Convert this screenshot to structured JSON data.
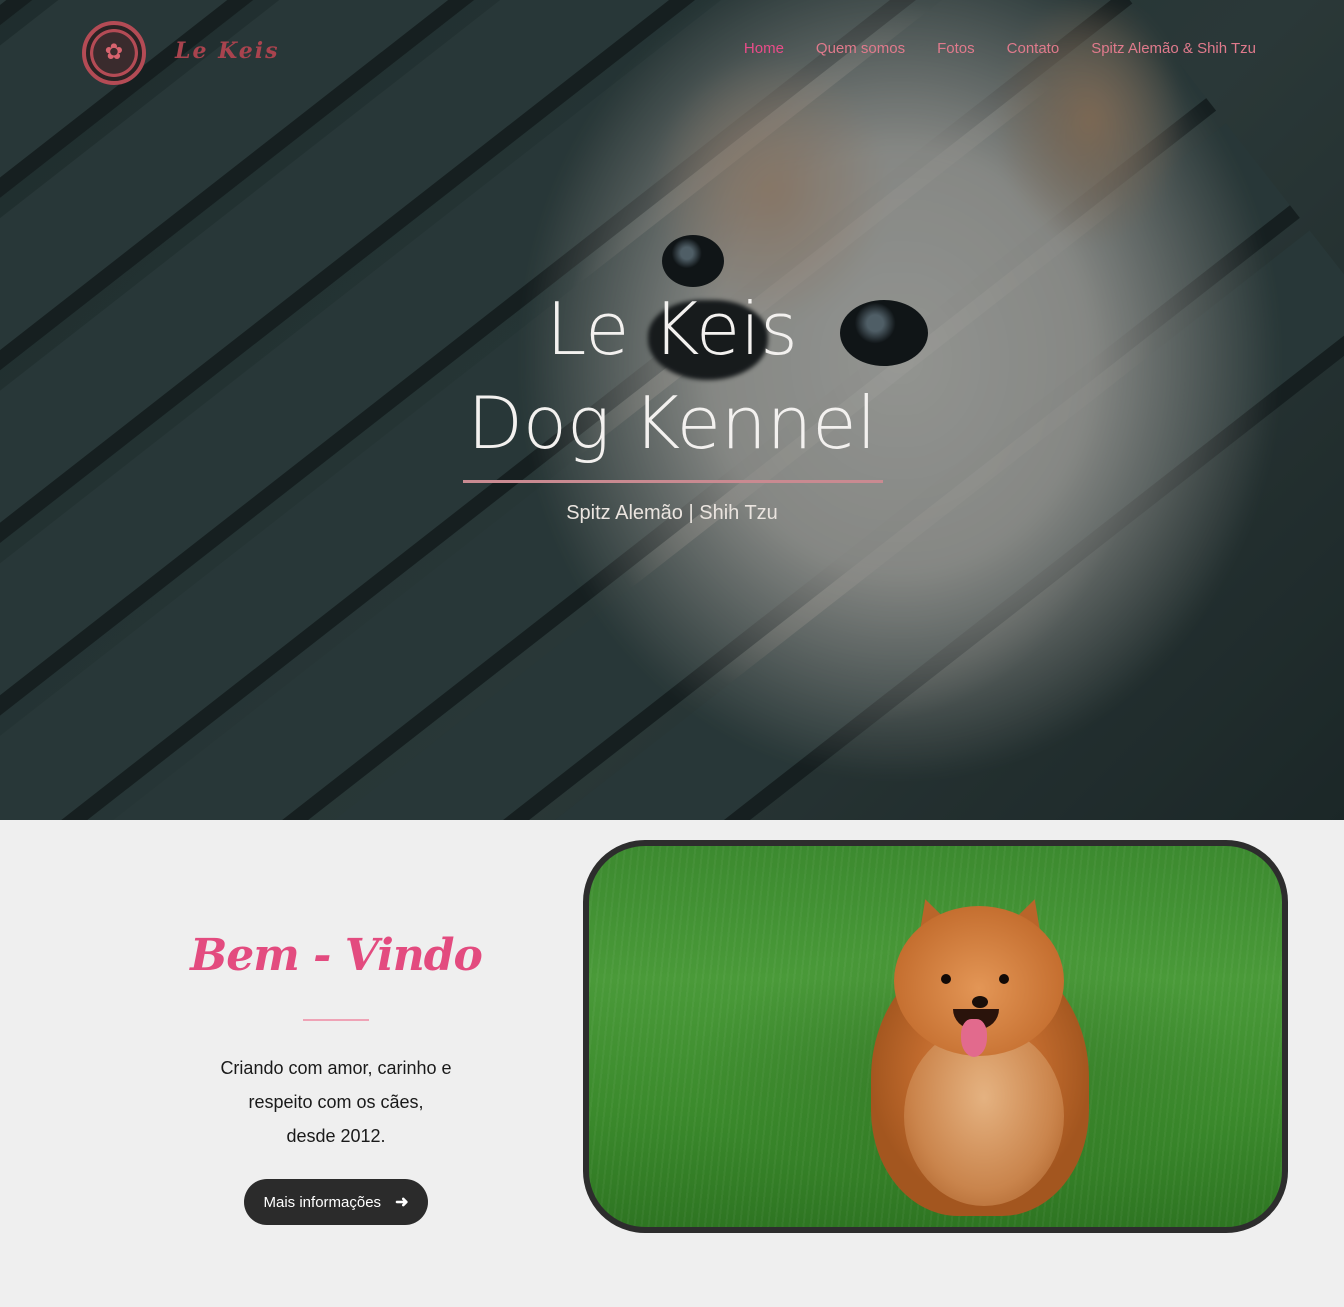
{
  "brand": {
    "logo_text": "Le  Keis"
  },
  "nav": {
    "items": [
      {
        "label": "Home",
        "active": true
      },
      {
        "label": "Quem somos"
      },
      {
        "label": "Fotos"
      },
      {
        "label": "Contato"
      },
      {
        "label": "Spitz Alemão & Shih Tzu"
      }
    ]
  },
  "hero": {
    "title_line1": "Le Keis",
    "title_line2": "Dog Kennel",
    "subtitle": "Spitz Alemão | Shih Tzu"
  },
  "welcome": {
    "title": "Bem - Vindo",
    "body_line1": "Criando com amor, carinho e",
    "body_line2": "respeito com os cães,",
    "body_line3": "desde 2012.",
    "button_label": "Mais informações"
  },
  "colors": {
    "accent_pink": "#e34b7f",
    "nav_pink": "#e07a8c",
    "button_dark": "#2b2b2b",
    "section_bg": "#efefef"
  },
  "icons": {
    "button_icon": "arrow-right-icon",
    "logo_icon": "dog-badge-icon"
  }
}
